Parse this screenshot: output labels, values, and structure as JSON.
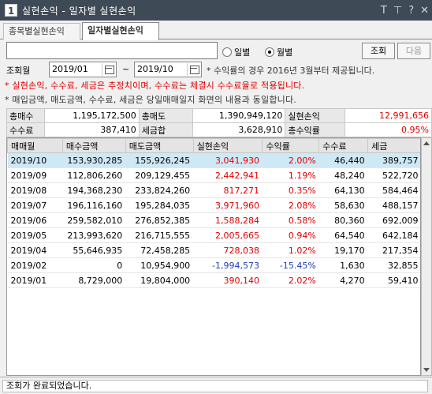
{
  "window": {
    "icon": "1",
    "title": "실현손익 - 일자별 실현손익",
    "icons": [
      "text-size-icon",
      "pin-icon",
      "help-icon",
      "close-icon"
    ]
  },
  "tabs": [
    {
      "label": "종목별실현손익"
    },
    {
      "label": "일자별실현손익"
    }
  ],
  "controls": {
    "account_value": "",
    "radio_daily": "일별",
    "radio_monthly": "월별",
    "radio_selected": "월별",
    "query_button": "조회",
    "next_button": "다음",
    "query_month_label": "조회월",
    "start_date": "2019/01",
    "tilde": "~",
    "end_date": "2019/10"
  },
  "notes": {
    "yield_note": "* 수익률의 경우 2016년 3월부터 제공됩니다.",
    "estimate_note": "* 실현손익, 수수료, 세금은 추정치이며, 수수료는 체결시 수수료율로 적용됩니다.",
    "same_note": "* 매입금액, 매도금액, 수수료, 세금은 당일매매일지 화면의 내용과 동일합니다."
  },
  "summary": {
    "total_buy_label": "총매수",
    "total_buy": "1,195,172,500",
    "total_sell_label": "총매도",
    "total_sell": "1,390,949,120",
    "realized_label": "실현손익",
    "realized": "12,991,656",
    "fee_label": "수수료",
    "fee": "387,410",
    "tax_label": "세금합",
    "tax": "3,628,910",
    "yield_label": "총수익률",
    "yield": "0.95%"
  },
  "grid": {
    "headers": [
      "매매월",
      "매수금액",
      "매도금액",
      "실현손익",
      "수익률",
      "수수료",
      "세금"
    ],
    "rows": [
      {
        "month": "2019/10",
        "buy": "153,930,285",
        "sell": "155,926,245",
        "pl": "3,041,930",
        "yield": "2.00%",
        "fee": "46,440",
        "tax": "389,757",
        "sign": "pos"
      },
      {
        "month": "2019/09",
        "buy": "112,806,260",
        "sell": "209,129,455",
        "pl": "2,442,941",
        "yield": "1.19%",
        "fee": "48,240",
        "tax": "522,720",
        "sign": "pos"
      },
      {
        "month": "2019/08",
        "buy": "194,368,230",
        "sell": "233,824,260",
        "pl": "817,271",
        "yield": "0.35%",
        "fee": "64,130",
        "tax": "584,464",
        "sign": "pos"
      },
      {
        "month": "2019/07",
        "buy": "196,116,160",
        "sell": "195,284,035",
        "pl": "3,971,960",
        "yield": "2.08%",
        "fee": "58,630",
        "tax": "488,157",
        "sign": "pos"
      },
      {
        "month": "2019/06",
        "buy": "259,582,010",
        "sell": "276,852,385",
        "pl": "1,588,284",
        "yield": "0.58%",
        "fee": "80,360",
        "tax": "692,009",
        "sign": "pos"
      },
      {
        "month": "2019/05",
        "buy": "213,993,620",
        "sell": "216,715,555",
        "pl": "2,005,665",
        "yield": "0.94%",
        "fee": "64,540",
        "tax": "642,184",
        "sign": "pos"
      },
      {
        "month": "2019/04",
        "buy": "55,646,935",
        "sell": "72,458,285",
        "pl": "728,038",
        "yield": "1.02%",
        "fee": "19,170",
        "tax": "217,354",
        "sign": "pos"
      },
      {
        "month": "2019/02",
        "buy": "0",
        "sell": "10,954,900",
        "pl": "-1,994,573",
        "yield": "-15.45%",
        "fee": "1,630",
        "tax": "32,855",
        "sign": "neg"
      },
      {
        "month": "2019/01",
        "buy": "8,729,000",
        "sell": "19,804,000",
        "pl": "390,140",
        "yield": "2.02%",
        "fee": "4,270",
        "tax": "59,410",
        "sign": "pos"
      }
    ]
  },
  "status": {
    "message": "조회가 완료되었습니다."
  },
  "colors": {
    "titlebar": "#3f4a57",
    "positive": "#e00000",
    "negative": "#1d3fb8",
    "selected_row": "#cfe8f5"
  }
}
